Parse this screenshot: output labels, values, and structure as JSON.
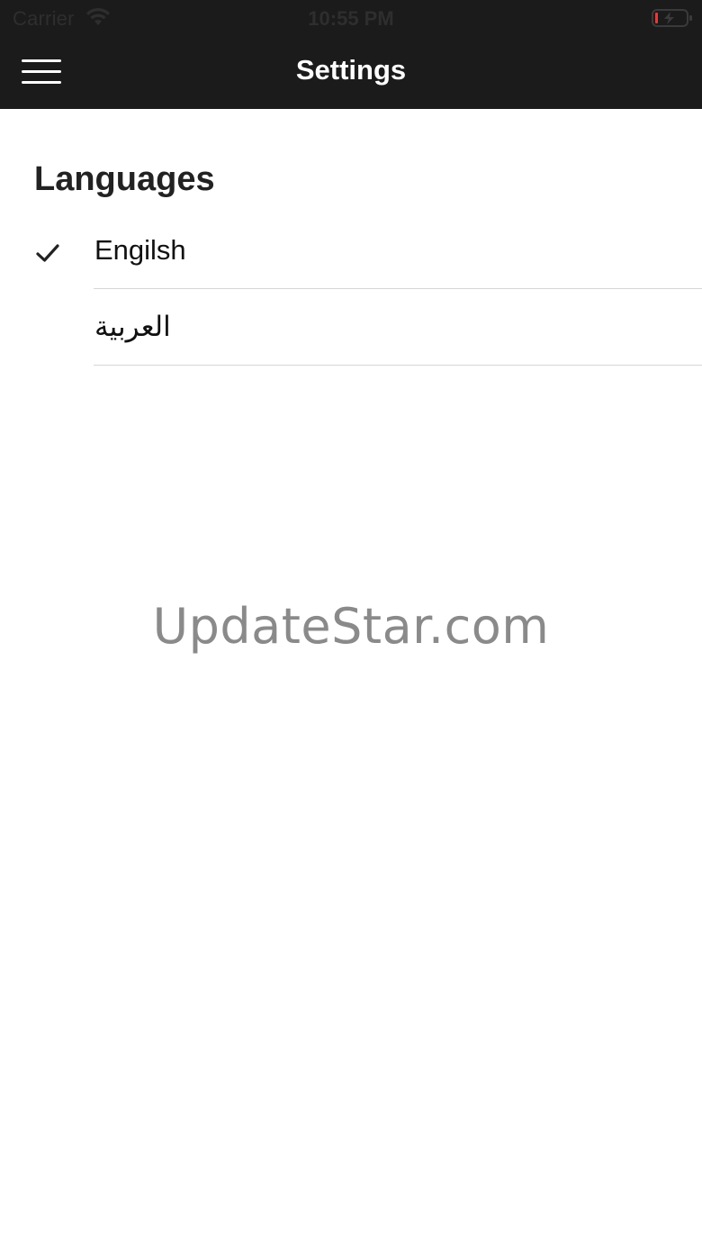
{
  "status_bar": {
    "carrier": "Carrier",
    "time": "10:55 PM",
    "wifi_icon": "wifi-icon",
    "battery_icon": "battery-charging-icon"
  },
  "nav": {
    "title": "Settings",
    "menu_icon": "hamburger-menu-icon"
  },
  "languages": {
    "title": "Languages",
    "items": [
      {
        "label": "Engilsh",
        "selected": true
      },
      {
        "label": "العربية",
        "selected": false
      }
    ]
  },
  "watermark": "UpdateStar.com",
  "colors": {
    "header_bg": "#1b1b1b",
    "battery_low": "#e23b3b",
    "divider": "#d6d6d6"
  }
}
